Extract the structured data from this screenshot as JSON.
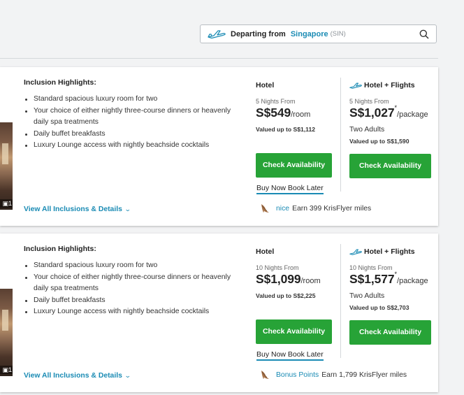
{
  "header": {
    "departing_label": "Departing from",
    "city": "Singapore",
    "code": "(SIN)"
  },
  "offers": [
    {
      "inclusion_title": "Inclusion Highlights:",
      "inclusions": [
        "Standard spacious luxury room for two",
        "Your choice of either nightly three-course dinners or heavenly daily spa treatments",
        "Daily buffet breakfasts",
        "Luxury Lounge access with nightly beachside cocktails"
      ],
      "photo_count": "1",
      "view_all": "View All Inclusions & Details",
      "hotel": {
        "title": "Hotel",
        "nights": "5 Nights From",
        "price": "S$549",
        "unit": "/room",
        "valued": "Valued up to S$1,112",
        "button": "Check Availability",
        "bnbl": "Buy Now Book Later"
      },
      "hotel_flights": {
        "title": "Hotel + Flights",
        "nights": "5 Nights From",
        "price": "S$1,027",
        "sup": "*",
        "unit": "/package",
        "adults": "Two Adults",
        "valued": "Valued up to S$1,590",
        "button": "Check Availability"
      },
      "miles_label": "nice",
      "miles_text": "Earn 399 KrisFlyer miles"
    },
    {
      "inclusion_title": "Inclusion Highlights:",
      "inclusions": [
        "Standard spacious luxury room for two",
        "Your choice of either nightly three-course dinners or heavenly daily spa treatments",
        "Daily buffet breakfasts",
        "Luxury Lounge access with nightly beachside cocktails"
      ],
      "photo_count": "1",
      "view_all": "View All Inclusions & Details",
      "hotel": {
        "title": "Hotel",
        "nights": "10 Nights From",
        "price": "S$1,099",
        "unit": "/room",
        "valued": "Valued up to S$2,225",
        "button": "Check Availability",
        "bnbl": "Buy Now Book Later"
      },
      "hotel_flights": {
        "title": "Hotel + Flights",
        "nights": "10 Nights From",
        "price": "S$1,577",
        "sup": "*",
        "unit": "/package",
        "adults": "Two Adults",
        "valued": "Valued up to S$2,703",
        "button": "Check Availability"
      },
      "miles_label": "Bonus Points",
      "miles_text": "Earn 1,799 KrisFlyer miles"
    }
  ],
  "icons": {
    "plane": "plane-icon",
    "search": "search-icon",
    "krisflyer": "krisflyer-bird-icon",
    "camera": "camera-icon"
  },
  "colors": {
    "accent": "#1a8bb4",
    "button": "#27a337",
    "background": "#f2f3f4"
  }
}
